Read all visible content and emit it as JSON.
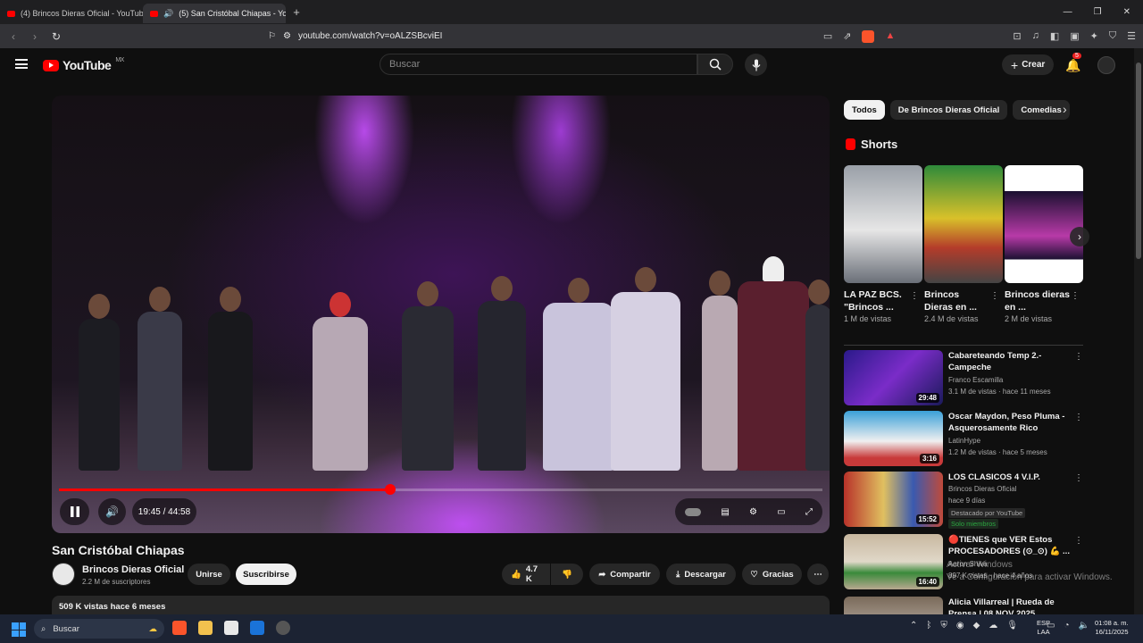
{
  "browser": {
    "tabs": [
      {
        "label": "(4) Brincos Dieras Oficial - YouTube"
      },
      {
        "label": "(5) San Cristóbal Chiapas - YouTube"
      }
    ],
    "url": "youtube.com/watch?v=oALZSBcviEI",
    "new_tab": "+",
    "tab_close": "✕",
    "win_min": "—",
    "win_max": "❐",
    "win_close": "✕",
    "extension_badge": "1"
  },
  "yt": {
    "region": "MX",
    "logo_text": "YouTube",
    "search_placeholder": "Buscar",
    "create_label": "Crear",
    "notif_count": "5"
  },
  "video": {
    "time": "19:45 / 44:58",
    "progress": 0.434,
    "title": "San Cristóbal Chiapas",
    "channel": "Brincos Dieras Oficial",
    "subs": "2.2 M de suscriptores",
    "join": "Unirse",
    "subscribe": "Suscribirse",
    "likes": "4.7 K",
    "share": "Compartir",
    "download": "Descargar",
    "thanks": "Gracias",
    "meta": "509 K vistas  hace 6 meses"
  },
  "chips": [
    "Todos",
    "De Brincos Dieras Oficial",
    "Comedias"
  ],
  "shorts": {
    "heading": "Shorts",
    "items": [
      {
        "title": "LA PAZ BCS. \"Brincos ...",
        "views": "1 M de vistas"
      },
      {
        "title": "Brincos Dieras en ...",
        "views": "2.4 M de vistas"
      },
      {
        "title": "Brincos dieras en ...",
        "views": "2 M de vistas"
      }
    ]
  },
  "recs": [
    {
      "title": "Cabareteando Temp 2.- Campeche",
      "channel": "Franco Escamilla",
      "meta": "3.1 M de vistas · hace 11 meses",
      "dur": "29:48"
    },
    {
      "title": "Oscar Maydon, Peso Pluma - Asquerosamente Rico",
      "channel": "LatinHype",
      "meta": "1.2 M de vistas · hace 5 meses",
      "dur": "3:16"
    },
    {
      "title": "LOS CLASICOS 4 V.I.P.",
      "channel": "Brincos Dieras Oficial",
      "meta": "hace 9 días",
      "dur": "15:52",
      "tag1": "Destacado por YouTube",
      "tag2": "Solo miembros"
    },
    {
      "title": "🔴TIENES que VER Estos PROCESADORES  (⊙_⊙) 💪 ...",
      "channel": "Aaron Shiva",
      "meta": "897 K vistas · hace 4 años",
      "dur": "16:40"
    },
    {
      "title": "Alicia Villarreal | Rueda de Prensa | 08 NOV 2025",
      "channel": "",
      "meta": "",
      "dur": ""
    }
  ],
  "watermark": {
    "line1": "Activar Windows",
    "line2": "Ve a Configuración para activar Windows."
  },
  "taskbar": {
    "search": "Buscar",
    "lang1": "ESP",
    "lang2": "LAA",
    "time": "01:08 a. m.",
    "date": "16/11/2025"
  }
}
